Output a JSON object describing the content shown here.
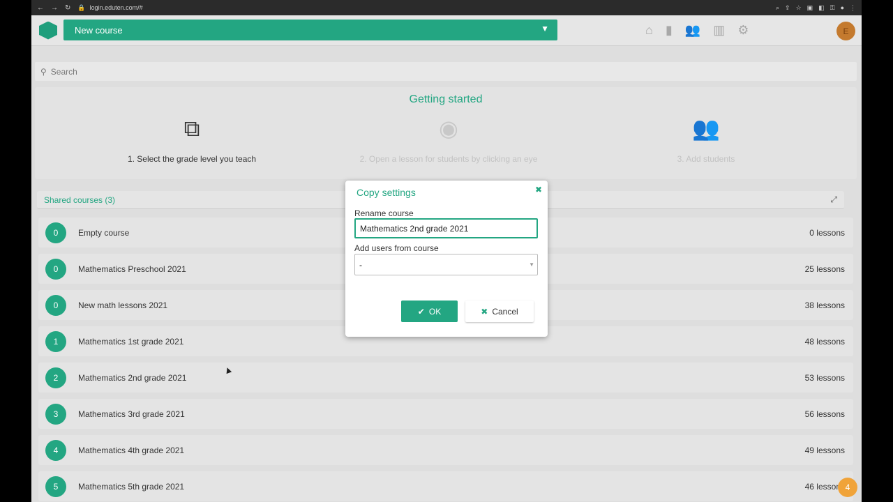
{
  "browser": {
    "url": "login.eduten.com/#"
  },
  "topbar": {
    "course_title": "New course",
    "avatar_initial": "E"
  },
  "search": {
    "placeholder": "Search"
  },
  "getting_started": {
    "title": "Getting started",
    "steps": [
      {
        "label": "1. Select the grade level you teach"
      },
      {
        "label": "2. Open a lesson for students by clicking an eye"
      },
      {
        "label": "3. Add students"
      }
    ]
  },
  "shared_courses": {
    "label": "Shared courses (3)"
  },
  "courses": [
    {
      "badge": "0",
      "name": "Empty course",
      "lessons": "0 lessons"
    },
    {
      "badge": "0",
      "name": "Mathematics Preschool 2021",
      "lessons": "25 lessons"
    },
    {
      "badge": "0",
      "name": "New math lessons 2021",
      "lessons": "38 lessons"
    },
    {
      "badge": "1",
      "name": "Mathematics 1st grade 2021",
      "lessons": "48 lessons"
    },
    {
      "badge": "2",
      "name": "Mathematics 2nd grade 2021",
      "lessons": "53 lessons"
    },
    {
      "badge": "3",
      "name": "Mathematics 3rd grade 2021",
      "lessons": "56 lessons"
    },
    {
      "badge": "4",
      "name": "Mathematics 4th grade 2021",
      "lessons": "49 lessons"
    },
    {
      "badge": "5",
      "name": "Mathematics 5th grade 2021",
      "lessons": "46 lessons"
    }
  ],
  "dialog": {
    "title": "Copy settings",
    "rename_label": "Rename course",
    "rename_value": "Mathematics 2nd grade 2021",
    "add_users_label": "Add users from course",
    "add_users_value": "-",
    "ok_label": "OK",
    "cancel_label": "Cancel"
  },
  "chat": {
    "badge": "4"
  },
  "colors": {
    "accent": "#23a682",
    "avatar": "#c47a2e"
  }
}
